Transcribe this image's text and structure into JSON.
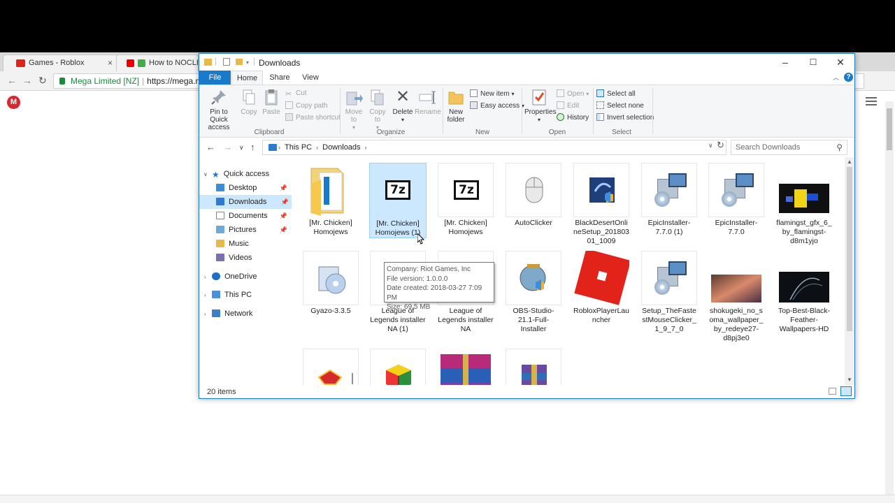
{
  "browser": {
    "tabs": [
      {
        "title": "Games - Roblox",
        "close": "×"
      },
      {
        "title": "How to NOCLIP"
      }
    ],
    "url_secure_label": "Mega Limited [NZ]",
    "url_text": "https://mega.n",
    "logo_letter": "M"
  },
  "explorer": {
    "title": "Downloads",
    "ribbon_tabs": [
      "File",
      "Home",
      "Share",
      "View"
    ],
    "clipboard": {
      "pin": "Pin to Quick access",
      "copy": "Copy",
      "paste": "Paste",
      "cut": "Cut",
      "copy_path": "Copy path",
      "paste_shortcut": "Paste shortcut",
      "group": "Clipboard"
    },
    "organize": {
      "move_to": "Move to",
      "copy_to": "Copy to",
      "delete": "Delete",
      "rename": "Rename",
      "group": "Organize"
    },
    "new": {
      "new_folder": "New folder",
      "new_item": "New item",
      "easy_access": "Easy access",
      "group": "New"
    },
    "open": {
      "properties": "Properties",
      "open": "Open",
      "edit": "Edit",
      "history": "History",
      "group": "Open"
    },
    "select": {
      "select_all": "Select all",
      "select_none": "Select none",
      "invert": "Invert selection",
      "group": "Select"
    },
    "breadcrumb": [
      "This PC",
      "Downloads"
    ],
    "search_placeholder": "Search Downloads",
    "nav": {
      "quick_access": "Quick access",
      "desktop": "Desktop",
      "downloads": "Downloads",
      "documents": "Documents",
      "pictures": "Pictures",
      "music": "Music",
      "videos": "Videos",
      "onedrive": "OneDrive",
      "this_pc": "This PC",
      "network": "Network"
    },
    "files": [
      "[Mr. Chicken] Homojews",
      "[Mr. Chicken] Homojews (1)",
      "[Mr. Chicken] Homojews",
      "AutoClicker",
      "BlackDesertOnlineSetup_20180301_1009",
      "EpicInstaller-7.7.0 (1)",
      "EpicInstaller-7.7.0",
      "flamingst_gfx_6_by_flamingst-d8m1yjo",
      "Gyazo-3.3.5",
      "League of Legends installer NA (1)",
      "League of Legends installer NA",
      "OBS-Studio-21.1-Full-Installer",
      "RobloxPlayerLauncher",
      "Setup_TheFastestMouseClicker_1_9_7_0",
      "shokugeki_no_soma_wallpaper_by_redeye27-d8pj3e0",
      "Top-Best-Black-Feather-Wallpapers-HD"
    ],
    "sevenz_label": "7z",
    "tooltip": {
      "company": "Company: Riot Games, Inc",
      "version": "File version: 1.0.0.0",
      "created": "Date created: 2018-03-27 7:09 PM",
      "size": "Size: 69.5 MB"
    },
    "status": "20 items"
  }
}
